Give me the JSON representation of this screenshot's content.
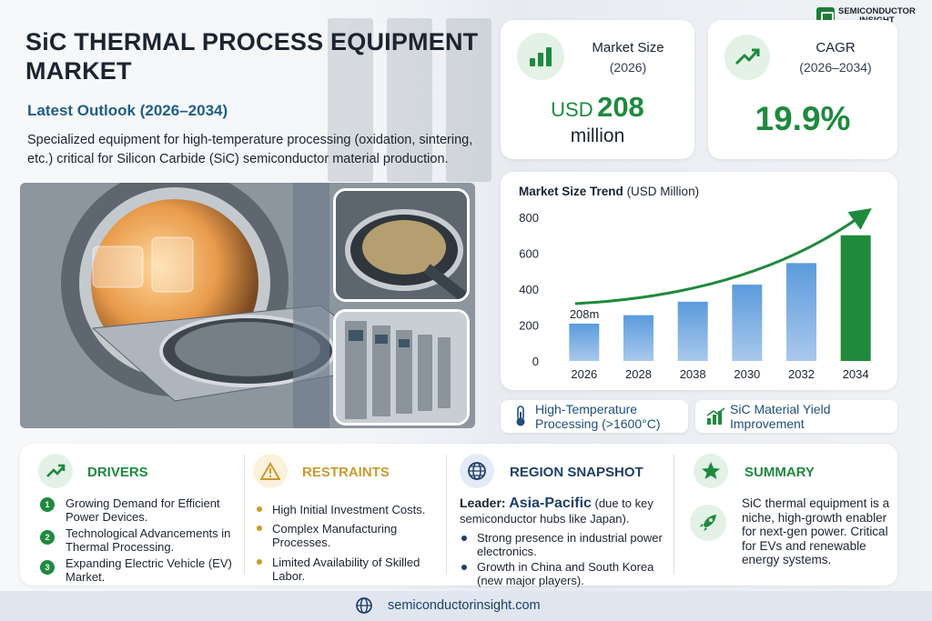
{
  "header": {
    "title": "SiC THERMAL PROCESS EQUIPMENT MARKET",
    "subtitle": "Latest Outlook (2026–2034)",
    "description": "Specialized equipment for high-temperature processing (oxidation, sintering, etc.) critical for Silicon Carbide (SiC) semiconductor material production."
  },
  "logo": {
    "line1": "SEMICONDUCTOR",
    "line2": "INSIGHT"
  },
  "kpi_market_size": {
    "label": "Market Size",
    "year": "(2026)",
    "currency": "USD",
    "value": "208",
    "unit": "million"
  },
  "kpi_cagr": {
    "label": "CAGR",
    "period": "(2026–2034)",
    "value": "19.9%"
  },
  "chart_title": {
    "main": "Market Size Trend",
    "unit": "(USD Million)"
  },
  "chart_data": {
    "type": "bar",
    "title": "Market Size Trend",
    "ylabel": "(USD Million)",
    "categories": [
      "2026",
      "2028",
      "2038",
      "2030",
      "2032",
      "2034"
    ],
    "values": [
      208,
      255,
      330,
      425,
      545,
      700
    ],
    "ylim": [
      0,
      800
    ],
    "yticks": [
      0,
      200,
      400,
      600,
      800
    ],
    "annotation": "208m",
    "grid": false,
    "colors": {
      "bar": "#a9c8ec",
      "bar_gradient": "#5b9bdc",
      "last_bar": "#1f8a3c",
      "trend_arrow": "#1f8a3c"
    }
  },
  "pills": [
    {
      "text": "High-Temperature Processing (>1600°C)",
      "icon": "thermometer-icon"
    },
    {
      "text": "SiC Material Yield Improvement",
      "icon": "bar-growth-icon"
    }
  ],
  "drivers": {
    "heading": "DRIVERS",
    "items": [
      "Growing Demand for Efficient Power Devices.",
      "Technological Advancements in Thermal Processing.",
      "Expanding Electric Vehicle (EV) Market."
    ],
    "numbers": [
      "1",
      "2",
      "3"
    ]
  },
  "restraints": {
    "heading": "RESTRAINTS",
    "items": [
      "High Initial Investment Costs.",
      "Complex Manufacturing Processes.",
      "Limited Availability of Skilled Labor."
    ]
  },
  "region": {
    "heading": "REGION SNAPSHOT",
    "leader_label": "Leader:",
    "leader_value": "Asia-Pacific",
    "leader_note": "(due to key semiconductor hubs like Japan).",
    "items": [
      "Strong presence in industrial power electronics.",
      "Growth in China and South Korea (new major players)."
    ]
  },
  "summary": {
    "heading": "SUMMARY",
    "text": "SiC thermal equipment is a niche, high-growth enabler for next-gen power. Critical for EVs and renewable energy systems."
  },
  "footer": {
    "url": "semiconductorinsight.com"
  },
  "colors": {
    "green": "#1e8a3e",
    "gold": "#c99a2e",
    "navy": "#1f3f6b",
    "blue_title": "#1f5e86"
  }
}
